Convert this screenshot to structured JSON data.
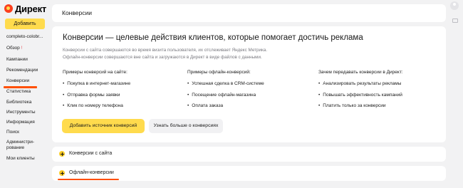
{
  "app": {
    "logo_text": "Директ",
    "add_button": "Добавить"
  },
  "sidebar": {
    "items": [
      {
        "label": "completo-colobr..."
      },
      {
        "label": "Обзор",
        "badge": "!"
      },
      {
        "label": "Кампании"
      },
      {
        "label": "Рекомендации"
      },
      {
        "label": "Конверсии",
        "active": true
      },
      {
        "label": "Статистика"
      },
      {
        "label": "Библиотека"
      },
      {
        "label": "Инструменты"
      },
      {
        "label": "Информация"
      },
      {
        "label": "Поиск"
      },
      {
        "label": "Админи­стри-"
      },
      {
        "label": "рование"
      },
      {
        "label": "Мои клиенты"
      }
    ]
  },
  "header": {
    "title": "Конверсии"
  },
  "intro": {
    "title": "Конверсии — целевые действия клиентов, которые помогает достичь реклама",
    "desc_1": "Конверсии с сайта совершаются во время визита пользователя, их отслеживает Яндекс Метрика.",
    "desc_2": "Офлайн-конверсии совершаются вне сайта и загружаются в Директ в виде файлов с данными."
  },
  "columns": [
    {
      "heading": "Примеры конверсий на сайте:",
      "items": [
        "Покупка в интернет-магазине",
        "Отправка формы заявки",
        "Клик по номеру телефона"
      ]
    },
    {
      "heading": "Примеры офлайн-конверсий:",
      "items": [
        "Успешная сделка в CRM-системе",
        "Посещение офлайн-магазина",
        "Оплата заказа"
      ]
    },
    {
      "heading": "Зачем передавать конверсии в Директ:",
      "items": [
        "Анализировать результаты рекламы",
        "Повышать эффективность кампаний",
        "Платить только за конверсии"
      ]
    }
  ],
  "buttons": {
    "add_source": "Добавить источник конверсий",
    "learn_more": "Узнать больше о конверсиях"
  },
  "accordions": [
    {
      "label": "Конверсии с сайта"
    },
    {
      "label": "Офлайн-конверсии"
    }
  ],
  "colors": {
    "accent_yellow": "#ffdb4d",
    "highlight_orange": "#ff4f00",
    "logo_red": "#fc3f1d"
  }
}
